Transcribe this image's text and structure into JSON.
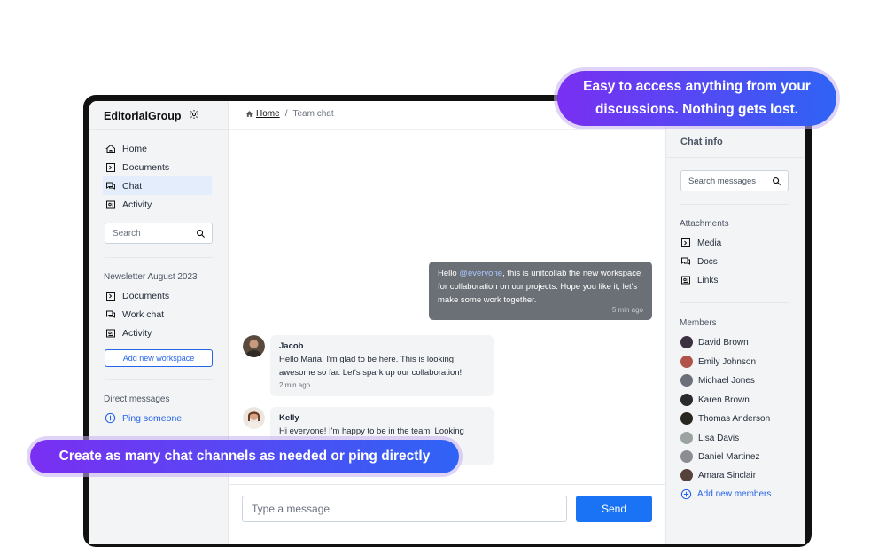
{
  "app": {
    "name": "EditorialGroup"
  },
  "breadcrumb": {
    "home": "Home",
    "separator": "/",
    "current": "Team chat"
  },
  "sidebar": {
    "nav": [
      {
        "label": "Home",
        "icon": "home-icon"
      },
      {
        "label": "Documents",
        "icon": "document-icon"
      },
      {
        "label": "Chat",
        "icon": "chat-icon",
        "active": true
      },
      {
        "label": "Activity",
        "icon": "activity-icon"
      }
    ],
    "search_placeholder": "Search",
    "workspace": {
      "name": "Newsletter August 2023",
      "items": [
        {
          "label": "Documents",
          "icon": "document-icon"
        },
        {
          "label": "Work chat",
          "icon": "chat-icon"
        },
        {
          "label": "Activity",
          "icon": "activity-icon"
        }
      ],
      "add_label": "Add new workspace"
    },
    "direct_messages": {
      "label": "Direct messages",
      "ping_label": "Ping someone"
    }
  },
  "chat": {
    "outgoing": {
      "text_before": "Hello ",
      "mention": "@everyone",
      "text_after": ", this is unitcollab the new workspace for collaboration  on our projects. Hope you like it, let's make some work together.",
      "time": "5 min ago"
    },
    "messages": [
      {
        "name": "Jacob",
        "text": "Hello Maria, I'm glad to be here. This is looking awesome so far. Let's spark up our collaboration!",
        "time": "2 min ago"
      },
      {
        "name": "Kelly",
        "text": "Hi everyone! I'm happy to be in the team. Looking"
      }
    ],
    "composer_placeholder": "Type a message",
    "send_label": "Send"
  },
  "info": {
    "title": "Chat info",
    "search_placeholder": "Search messages",
    "attachments_label": "Attachments",
    "attachments": [
      {
        "label": "Media",
        "icon": "media-icon"
      },
      {
        "label": "Docs",
        "icon": "docs-icon"
      },
      {
        "label": "Links",
        "icon": "links-icon"
      }
    ],
    "members_label": "Members",
    "members": [
      {
        "name": "David Brown",
        "color": "#3b3340"
      },
      {
        "name": "Emily Johnson",
        "color": "#b0544a"
      },
      {
        "name": "Michael Jones",
        "color": "#6b6f7a"
      },
      {
        "name": "Karen Brown",
        "color": "#2b2b2f"
      },
      {
        "name": "Thomas Anderson",
        "color": "#2a2622"
      },
      {
        "name": "Lisa Davis",
        "color": "#9aa3a0"
      },
      {
        "name": "Daniel Martinez",
        "color": "#8a8e92"
      },
      {
        "name": "Amara Sinclair",
        "color": "#55423a"
      }
    ],
    "add_members_label": "Add new members"
  },
  "callouts": {
    "top": "Easy to access anything from your discussions. Nothing gets lost.",
    "bottom": "Create as many chat channels as needed or ping directly"
  }
}
